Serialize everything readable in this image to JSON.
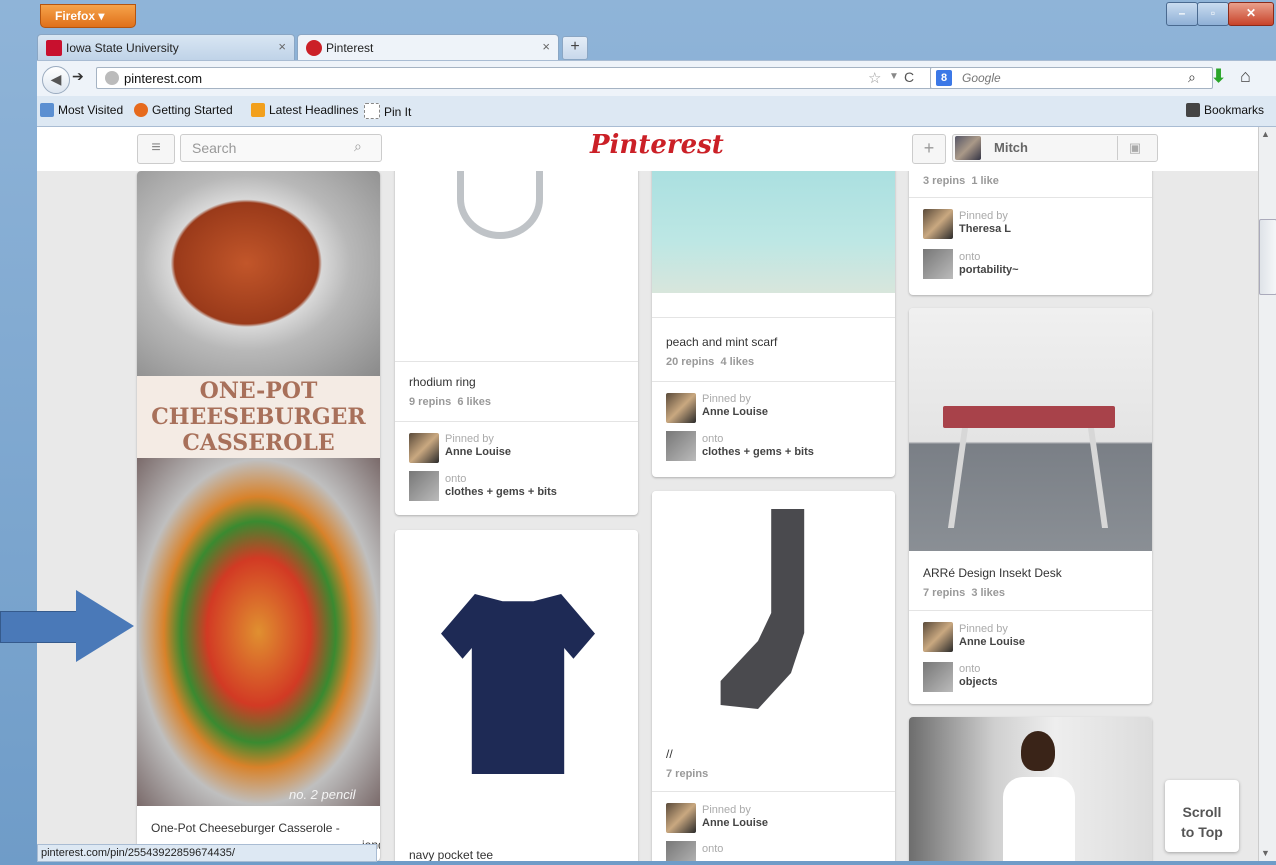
{
  "browser": {
    "app_button": "Firefox ▾",
    "tabs": [
      {
        "label": "Iowa State University"
      },
      {
        "label": "Pinterest"
      }
    ],
    "url": "pinterest.com",
    "search_placeholder": "Google",
    "bookmarks": [
      "Most Visited",
      "Getting Started",
      "Latest Headlines",
      "Pin It"
    ],
    "bookmarks_menu": "Bookmarks",
    "status_url": "pinterest.com/pin/25543922859674435/"
  },
  "pinterest": {
    "logo": "Pinterest",
    "search_placeholder": "Search",
    "user": "Mitch",
    "scroll_top": [
      "Scroll",
      "to Top"
    ]
  },
  "pins": {
    "casserole": {
      "overlay_lines": [
        "ONE-POT",
        "CHEESEBURGER",
        "CASSEROLE"
      ],
      "watermark": "no. 2 pencil",
      "title": "One-Pot Cheeseburger Casserole -",
      "title_cont": "iendly!"
    },
    "ring": {
      "title": "rhodium ring",
      "repins": "9 repins",
      "likes": "6 likes",
      "pinned_by_label": "Pinned by",
      "pinner": "Anne Louise",
      "onto_label": "onto",
      "board": "clothes + gems + bits"
    },
    "tee": {
      "title": "navy pocket tee"
    },
    "scarf": {
      "title": "peach and mint scarf",
      "repins": "20 repins",
      "likes": "4 likes",
      "pinned_by_label": "Pinned by",
      "pinner": "Anne Louise",
      "onto_label": "onto",
      "board": "clothes + gems + bits"
    },
    "sock": {
      "title": "//",
      "repins": "7 repins",
      "pinned_by_label": "Pinned by",
      "pinner": "Anne Louise",
      "onto_label": "onto"
    },
    "theresa": {
      "repins": "3 repins",
      "likes": "1 like",
      "pinned_by_label": "Pinned by",
      "pinner": "Theresa L",
      "onto_label": "onto",
      "board": "portability~"
    },
    "desk": {
      "title": "ARRé Design Insekt Desk",
      "repins": "7 repins",
      "likes": "3 likes",
      "pinned_by_label": "Pinned by",
      "pinner": "Anne Louise",
      "onto_label": "onto",
      "board": "objects"
    }
  },
  "colors": {
    "pinterest_red": "#cb2027",
    "arrow_blue": "#4a79b8"
  }
}
